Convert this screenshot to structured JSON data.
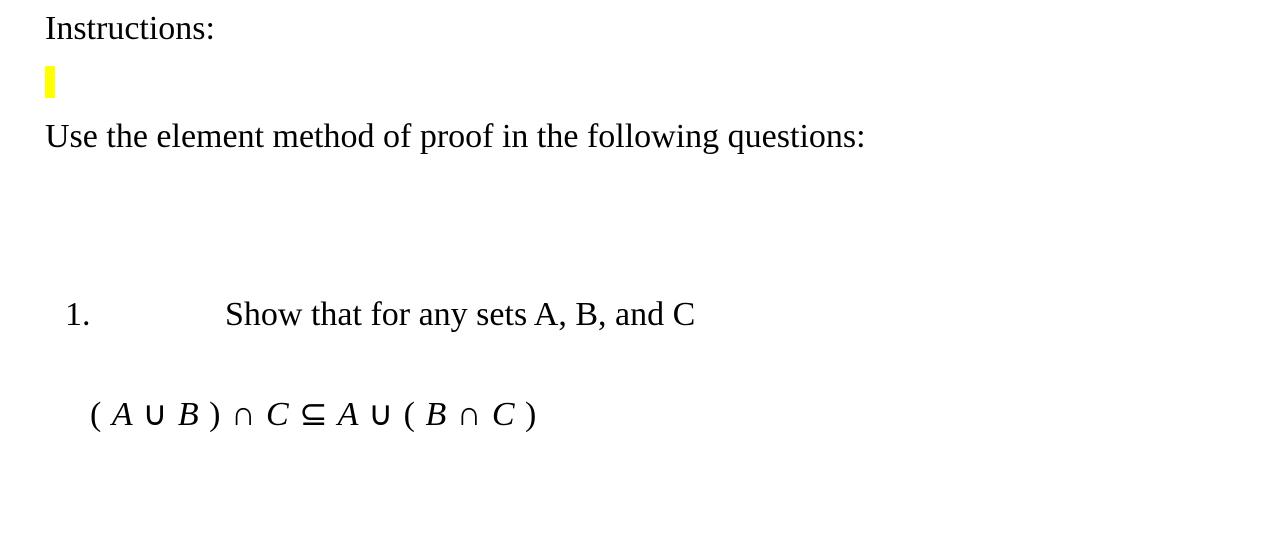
{
  "instructions": {
    "heading": "Instructions:",
    "method_line": "Use the element method of proof in the following questions:"
  },
  "question": {
    "number": "1.",
    "prompt": "Show that for any sets  A,  B,  and  C",
    "formula": {
      "lparen1": "( ",
      "A1": "A",
      "sp1": " ",
      "union1": "∪",
      "sp2": " ",
      "B1": "B",
      "rparen1": " )",
      "sp3": " ",
      "inter1": "∩",
      "sp4": "  ",
      "C1": "C",
      "sp5": "   ",
      "subset": "⊆",
      "sp6": "   ",
      "A2": "A",
      "sp7": "  ",
      "union2": "∪",
      "sp8": "  ",
      "lparen2": "( ",
      "B2": "B",
      "sp9": "  ",
      "inter2": "∩",
      "sp10": "  ",
      "C2": "C",
      "rparen2": " )"
    }
  }
}
